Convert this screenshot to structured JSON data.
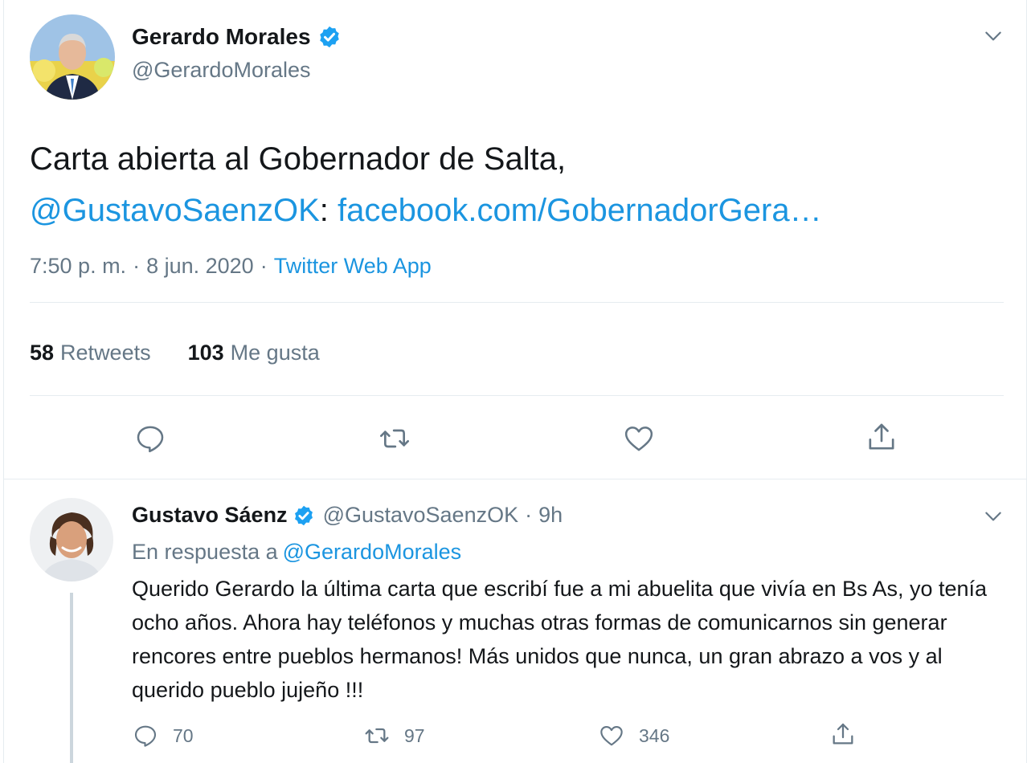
{
  "main_tweet": {
    "author_name": "Gerardo Morales",
    "author_handle": "@GerardoMorales",
    "text_line1": "Carta abierta al Gobernador de Salta,",
    "mention": "@GustavoSaenzOK",
    "colon": ":",
    "link": "facebook.com/GobernadorGera…",
    "time": "7:50 p. m.",
    "date": "8 jun. 2020",
    "separator": "·",
    "source": "Twitter Web App",
    "retweets_count": "58",
    "retweets_label": "Retweets",
    "likes_count": "103",
    "likes_label": "Me gusta",
    "icons": [
      "verified-icon",
      "chevron-down-icon",
      "reply-icon",
      "retweet-icon",
      "like-icon",
      "share-icon"
    ]
  },
  "reply_tweet": {
    "author_name": "Gustavo Sáenz",
    "author_handle": "@GustavoSaenzOK",
    "separator": "·",
    "time": "9h",
    "in_reply_label": "En respuesta a",
    "in_reply_handle": "@GerardoMorales",
    "text": "Querido Gerardo la última carta que escribí fue a mi abuelita que vivía en Bs As, yo tenía ocho años. Ahora hay teléfonos y muchas otras formas de comunicarnos sin generar rencores entre pueblos hermanos! Más unidos que nunca, un gran abrazo a vos y al querido pueblo jujeño !!!",
    "reply_count": "70",
    "retweet_count": "97",
    "like_count": "346"
  },
  "colors": {
    "link": "#1b95e0",
    "verified": "#1da1f2",
    "secondary_text": "#657786",
    "divider": "#e6ecf0"
  }
}
